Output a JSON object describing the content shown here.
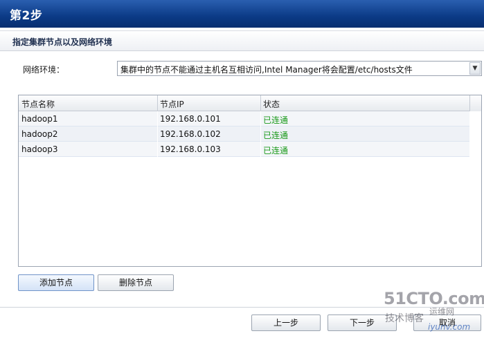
{
  "header": {
    "title": "第2步"
  },
  "subheader": {
    "title": "指定集群节点以及网络环境"
  },
  "network": {
    "label": "网络环境：",
    "selected": "集群中的节点不能通过主机名互相访问,Intel Manager将会配置/etc/hosts文件"
  },
  "table": {
    "columns": [
      "节点名称",
      "节点IP",
      "状态"
    ],
    "rows": [
      {
        "name": "hadoop1",
        "ip": "192.168.0.101",
        "status": "已连通"
      },
      {
        "name": "hadoop2",
        "ip": "192.168.0.102",
        "status": "已连通"
      },
      {
        "name": "hadoop3",
        "ip": "192.168.0.103",
        "status": "已连通"
      }
    ]
  },
  "actions": {
    "add_node": "添加节点",
    "delete_node": "删除节点"
  },
  "footer": {
    "prev": "上一步",
    "next": "下一步",
    "cancel": "取消"
  },
  "watermark": {
    "site": "51CTO.com",
    "blog": "技术博客",
    "ops": "运维网",
    "url": "iyunv.com"
  },
  "colors": {
    "header_bg": "#0b3a86",
    "status_ok": "#1a9a1a"
  }
}
